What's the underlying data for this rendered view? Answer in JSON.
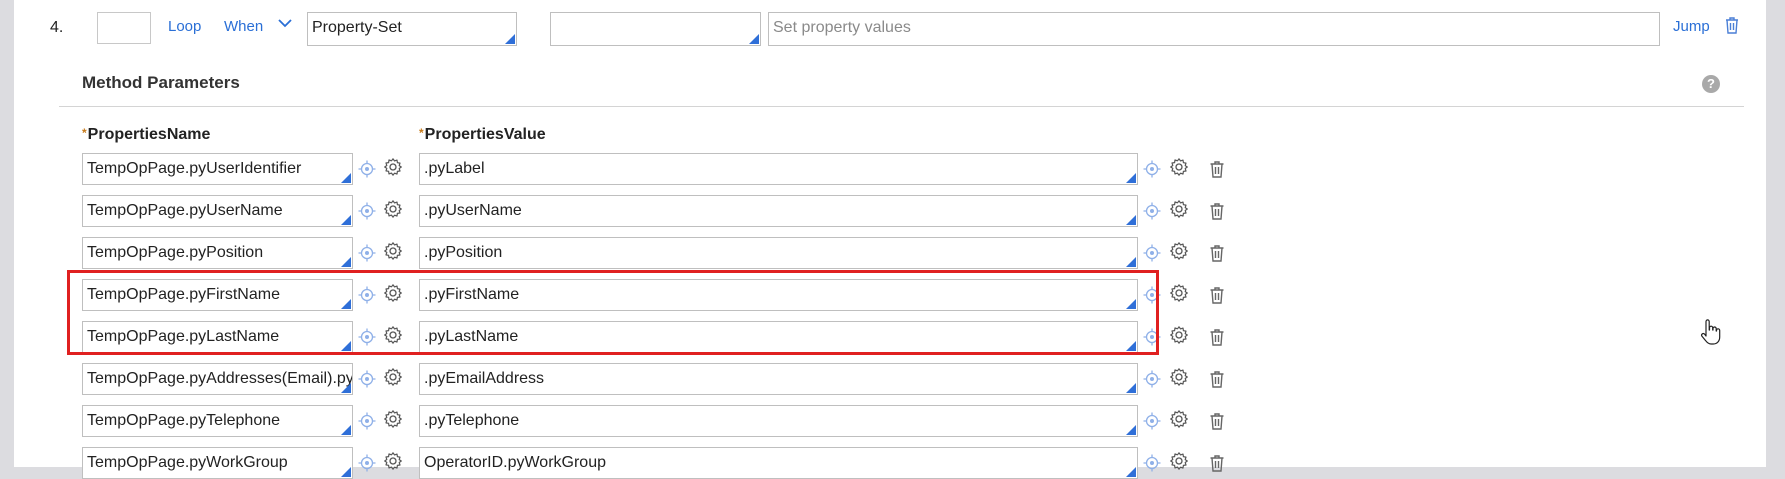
{
  "step": {
    "number": "4.",
    "loop_label": "Loop",
    "when_label": "When",
    "method_value": "Property-Set",
    "step_page_value": "",
    "description_placeholder": "Set property values",
    "jump_label": "Jump"
  },
  "method_params": {
    "title": "Method Parameters",
    "help_icon_text": "?",
    "col_name": "PropertiesName",
    "col_value": "PropertiesValue",
    "required_marker": "*",
    "rows": [
      {
        "name": "TempOpPage.pyUserIdentifier",
        "value": ".pyLabel"
      },
      {
        "name": "TempOpPage.pyUserName",
        "value": ".pyUserName"
      },
      {
        "name": "TempOpPage.pyPosition",
        "value": ".pyPosition"
      },
      {
        "name": "TempOpPage.pyFirstName",
        "value": ".pyFirstName"
      },
      {
        "name": "TempOpPage.pyLastName",
        "value": ".pyLastName"
      },
      {
        "name": "TempOpPage.pyAddresses(Email).py",
        "value": ".pyEmailAddress"
      },
      {
        "name": "TempOpPage.pyTelephone",
        "value": ".pyTelephone"
      },
      {
        "name": "TempOpPage.pyWorkGroup",
        "value": "OperatorID.pyWorkGroup"
      }
    ]
  },
  "colors": {
    "link": "#2a6fd6",
    "highlight_box": "#e02020",
    "required_star": "#c77a1a"
  },
  "icons": [
    "chevron-down-icon",
    "trash-icon",
    "help-icon",
    "target-icon",
    "gear-icon",
    "hand-cursor-icon"
  ]
}
